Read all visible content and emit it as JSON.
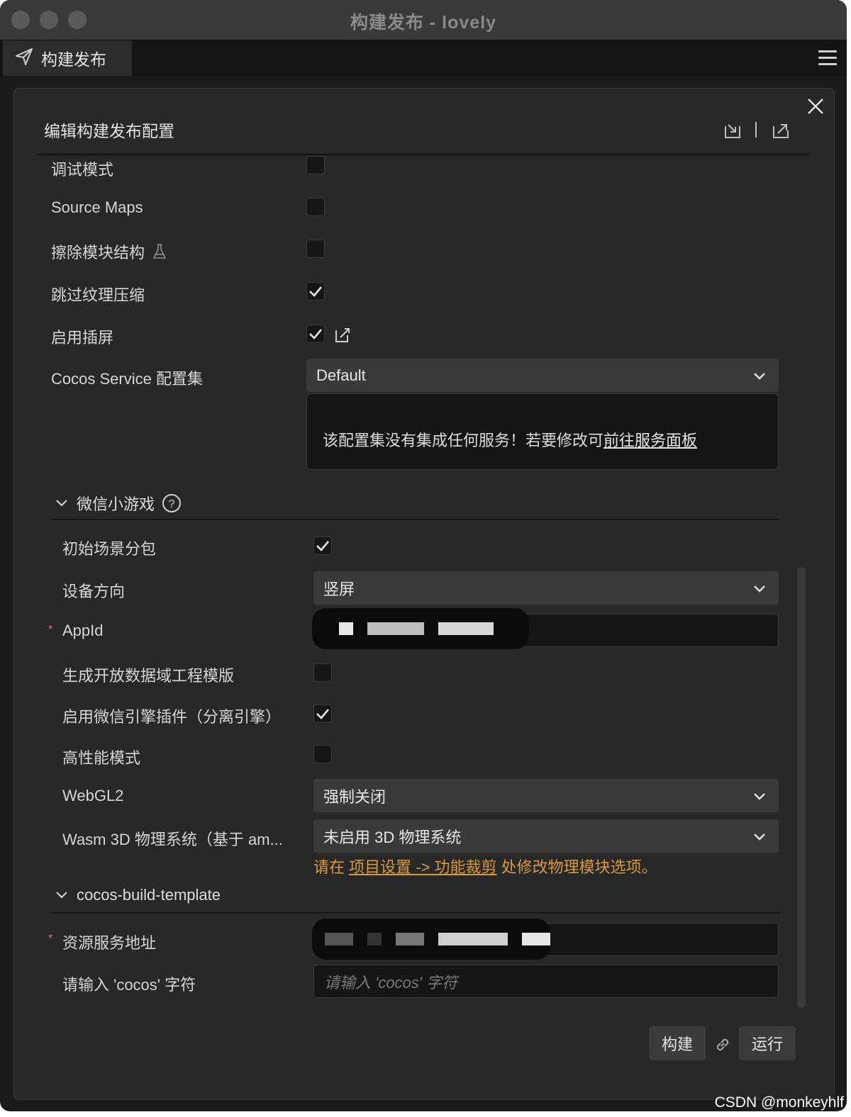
{
  "window": {
    "title": "构建发布 - lovely"
  },
  "tab": {
    "label": "构建发布"
  },
  "panel": {
    "title": "编辑构建发布配置"
  },
  "options": {
    "debug_mode": {
      "label": "调试模式",
      "checked": false
    },
    "source_maps": {
      "label": "Source Maps",
      "checked": false
    },
    "erase_modules": {
      "label": "擦除模块结构",
      "checked": false
    },
    "skip_compress": {
      "label": "跳过纹理压缩",
      "checked": true
    },
    "splash": {
      "label": "启用插屏",
      "checked": true
    },
    "cocos_service": {
      "label": "Cocos Service 配置集",
      "value": "Default"
    }
  },
  "notice": {
    "text": "该配置集没有集成任何服务！若要修改可",
    "link": "前往服务面板"
  },
  "wechat": {
    "section_title": "微信小游戏",
    "initial_scene_subpackage": {
      "label": "初始场景分包",
      "checked": true
    },
    "orientation": {
      "label": "设备方向",
      "value": "竖屏"
    },
    "appid": {
      "label": "AppId",
      "required_mark": "*"
    },
    "open_data": {
      "label": "生成开放数据域工程模版",
      "checked": false
    },
    "engine_plugin": {
      "label": "启用微信引擎插件（分离引擎）",
      "checked": true
    },
    "high_perf": {
      "label": "高性能模式",
      "checked": false
    },
    "webgl2": {
      "label": "WebGL2",
      "value": "强制关闭"
    },
    "wasm_physics": {
      "label": "Wasm 3D 物理系统（基于 am...",
      "value": "未启用 3D 物理系统"
    },
    "hint": {
      "prefix": "请在 ",
      "link": "项目设置 -> 功能裁剪",
      "suffix": " 处修改物理模块选项。"
    }
  },
  "template": {
    "section_title": "cocos-build-template",
    "resource_server": {
      "label": "资源服务地址",
      "required_mark": "*"
    },
    "cocos_input": {
      "label": "请输入 'cocos' 字符",
      "placeholder": "请输入 'cocos' 字符"
    }
  },
  "actions": {
    "build": "构建",
    "run": "运行"
  },
  "watermark": "CSDN @monkeyhlf"
}
